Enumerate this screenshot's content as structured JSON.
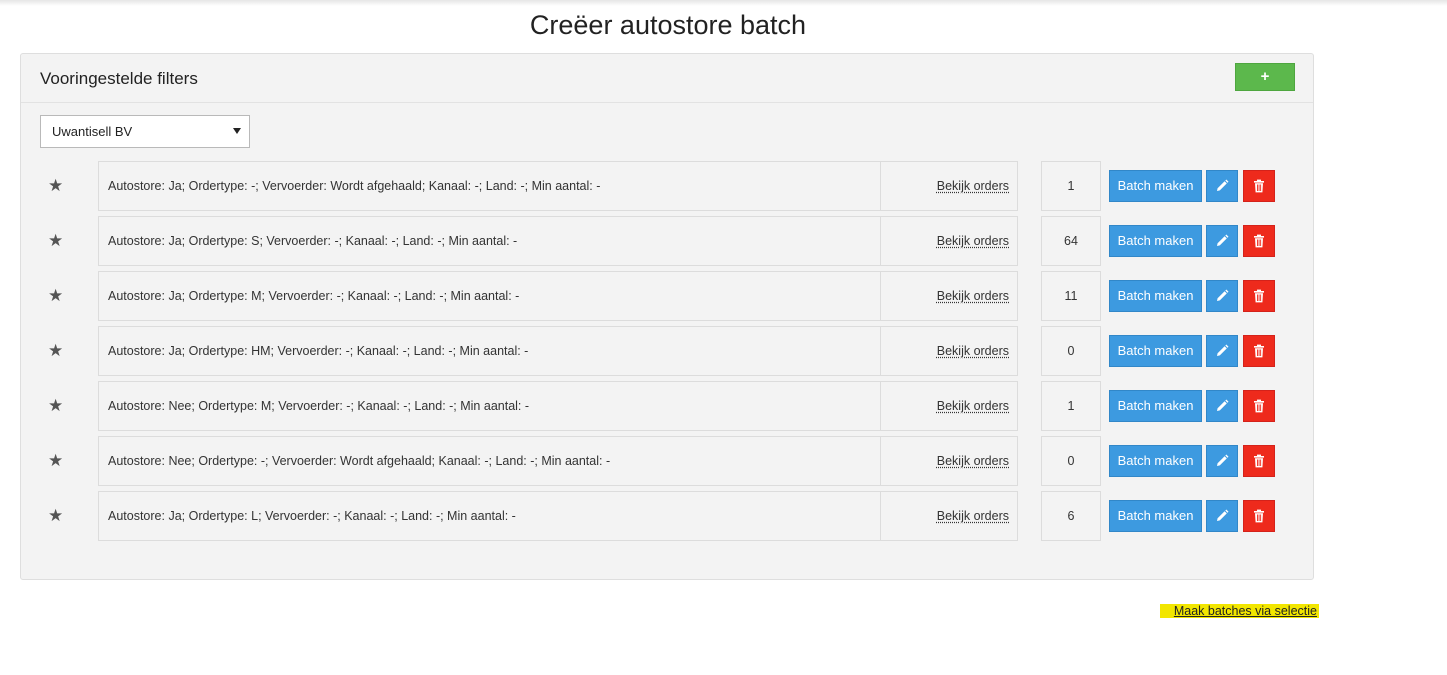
{
  "page": {
    "title": "Creëer autostore batch"
  },
  "panel": {
    "title": "Vooringestelde filters",
    "add_label": "+",
    "company_select": {
      "selected": "Uwantisell BV"
    }
  },
  "filters": [
    {
      "description": "Autostore: Ja; Ordertype: -; Vervoerder: Wordt afgehaald; Kanaal: -; Land: -; Min aantal: -",
      "link": "Bekijk orders",
      "count": "1",
      "batch_label": "Batch maken"
    },
    {
      "description": "Autostore: Ja; Ordertype: S; Vervoerder: -; Kanaal: -; Land: -; Min aantal: -",
      "link": "Bekijk orders",
      "count": "64",
      "batch_label": "Batch maken"
    },
    {
      "description": "Autostore: Ja; Ordertype: M; Vervoerder: -; Kanaal: -; Land: -; Min aantal: -",
      "link": "Bekijk orders",
      "count": "11",
      "batch_label": "Batch maken"
    },
    {
      "description": "Autostore: Ja; Ordertype: HM; Vervoerder: -; Kanaal: -; Land: -; Min aantal: -",
      "link": "Bekijk orders",
      "count": "0",
      "batch_label": "Batch maken"
    },
    {
      "description": "Autostore: Nee; Ordertype: M; Vervoerder: -; Kanaal: -; Land: -; Min aantal: -",
      "link": "Bekijk orders",
      "count": "1",
      "batch_label": "Batch maken"
    },
    {
      "description": "Autostore: Nee; Ordertype: -; Vervoerder: Wordt afgehaald; Kanaal: -; Land: -; Min aantal: -",
      "link": "Bekijk orders",
      "count": "0",
      "batch_label": "Batch maken"
    },
    {
      "description": "Autostore: Ja; Ordertype: L; Vervoerder: -; Kanaal: -; Land: -; Min aantal: -",
      "link": "Bekijk orders",
      "count": "6",
      "batch_label": "Batch maken"
    }
  ],
  "footer": {
    "selection_link": "Maak batches via selectie"
  },
  "colors": {
    "add_button": "#5cb84c",
    "primary_button": "#3d9ae0",
    "danger_button": "#ee2a1c",
    "highlight": "#f2e600"
  },
  "icons": {
    "favorite": "star-icon",
    "edit": "pencil-icon",
    "delete": "trash-icon",
    "dropdown": "caret-down-icon"
  }
}
